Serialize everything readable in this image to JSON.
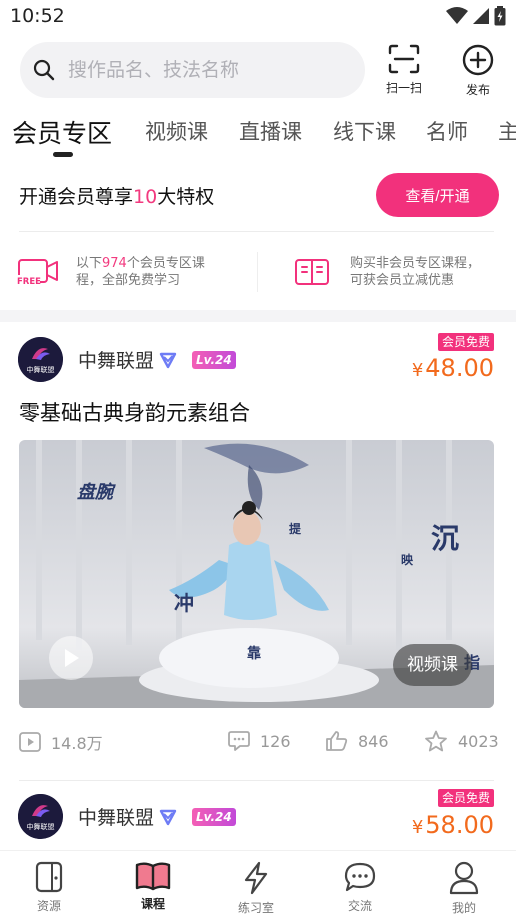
{
  "status_bar": {
    "time": "10:52"
  },
  "search": {
    "placeholder": "搜作品名、技法名称"
  },
  "top_actions": {
    "scan_label": "扫一扫",
    "publish_label": "发布"
  },
  "tabs": [
    {
      "label": "会员专区",
      "active": true
    },
    {
      "label": "视频课"
    },
    {
      "label": "直播课"
    },
    {
      "label": "线下课"
    },
    {
      "label": "名师"
    },
    {
      "label": "主"
    }
  ],
  "member": {
    "title_prefix": "开通会员尊享",
    "title_highlight": "10",
    "title_suffix": "大特权",
    "button_label": "查看/开通"
  },
  "perks": {
    "free": {
      "line1_prefix": "以下",
      "count": "974",
      "line1_suffix": "个会员专区课",
      "line2": "程，全部免费学习"
    },
    "discount": {
      "line1": "购买非会员专区课程，",
      "line2": "可获会员立减优惠"
    },
    "free_icon_text": "FREE"
  },
  "courses": [
    {
      "author": "中舞联盟",
      "avatar_text": "中舞联盟",
      "level": "Lv.24",
      "badge": "会员免费",
      "price_symbol": "¥",
      "price": "48.00",
      "title": "零基础古典身韵元素组合",
      "media_tag": "视频课",
      "views": "14.8万",
      "comments": "126",
      "likes": "846",
      "favorites": "4023"
    },
    {
      "author": "中舞联盟",
      "avatar_text": "中舞联盟",
      "level": "Lv.24",
      "badge": "会员免费",
      "price_symbol": "¥",
      "price": "58.00"
    }
  ],
  "bottom_nav": [
    {
      "label": "资源"
    },
    {
      "label": "课程",
      "active": true
    },
    {
      "label": "练习室"
    },
    {
      "label": "交流"
    },
    {
      "label": "我的"
    }
  ],
  "colors": {
    "accent": "#f2317c",
    "price": "#f26a1d",
    "verify": "#6e7cf5"
  }
}
